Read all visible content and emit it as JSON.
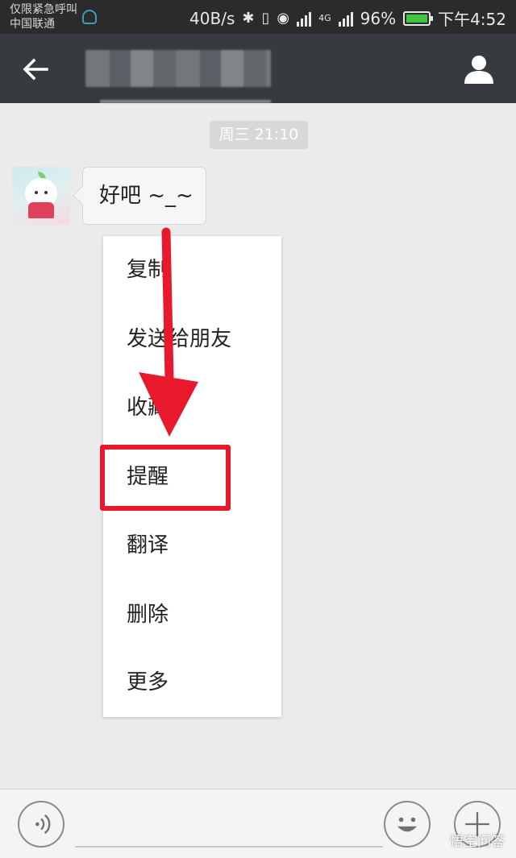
{
  "status_bar": {
    "carrier_line1": "仅限紧急呼叫",
    "carrier_line2": "中国联通",
    "speed": "40B/s",
    "network": "4G",
    "battery": "96%",
    "time": "下午4:52",
    "battery_color": "#3ec63e"
  },
  "title_bar": {
    "back_icon": "arrow-left-icon",
    "profile_icon": "person-icon",
    "background": "#373a3f"
  },
  "chat": {
    "timestamp": "周三 21:10",
    "message_text": "好吧 ~_~"
  },
  "context_menu": {
    "items": [
      {
        "label": "复制"
      },
      {
        "label": "发送给朋友"
      },
      {
        "label": "收藏"
      },
      {
        "label": "提醒"
      },
      {
        "label": "翻译"
      },
      {
        "label": "删除"
      },
      {
        "label": "更多"
      }
    ],
    "highlighted_item": "提醒",
    "annotation_color": "#e8192c"
  },
  "input_bar": {
    "voice_icon": "voice-icon",
    "emoji_icon": "emoji-icon",
    "plus_icon": "plus-icon"
  },
  "watermark": "悟空问答"
}
